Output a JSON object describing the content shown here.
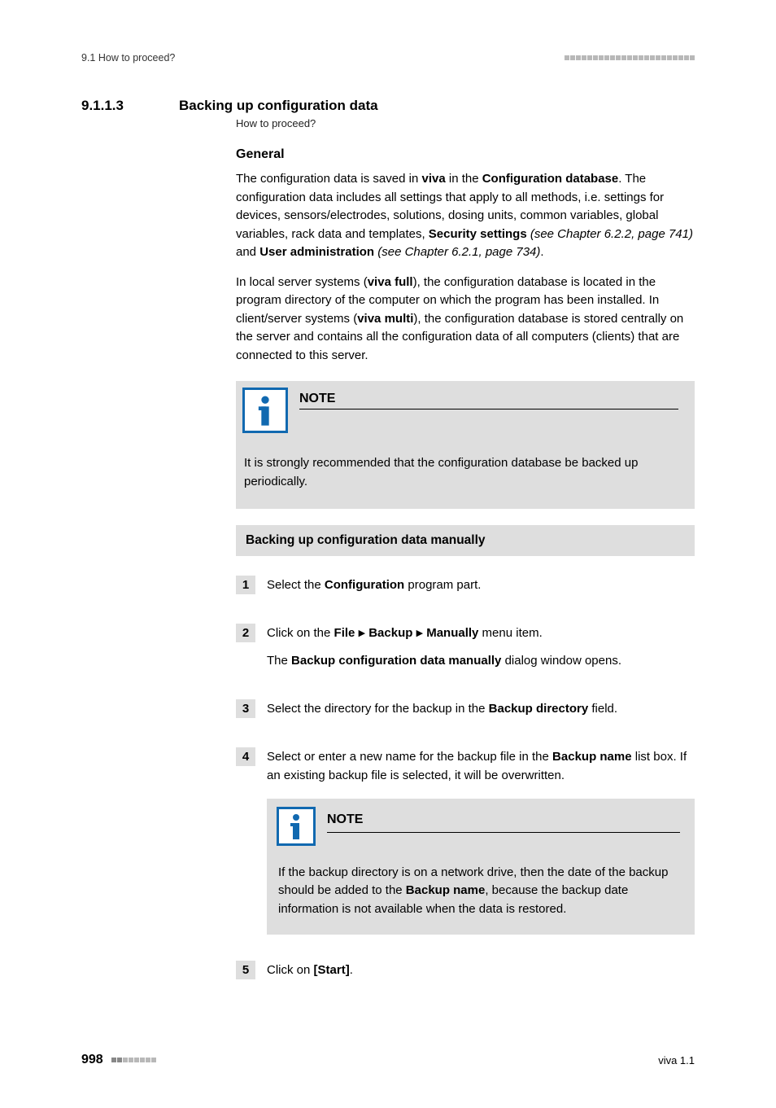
{
  "header": {
    "left": "9.1 How to proceed?"
  },
  "section": {
    "number": "9.1.1.3",
    "title": "Backing up configuration data",
    "subtitle": "How to proceed?"
  },
  "general": {
    "heading": "General",
    "p1a": "The configuration data is saved in ",
    "p1b": "viva",
    "p1c": " in the ",
    "p1d": "Configuration database",
    "p1e": ". The configuration data includes all settings that apply to all methods, i.e. settings for devices, sensors/electrodes, solutions, dosing units, common variables, global variables, rack data and templates, ",
    "p1f": "Security settings",
    "p1g": " (see Chapter 6.2.2, page 741)",
    "p1h": " and ",
    "p1i": "User administration",
    "p1j": " (see Chapter 6.2.1, page 734)",
    "p1k": ".",
    "p2a": "In local server systems (",
    "p2b": "viva full",
    "p2c": "), the configuration database is located in the program directory of the computer on which the program has been installed. In client/server systems (",
    "p2d": "viva multi",
    "p2e": "), the configuration database is stored centrally on the server and contains all the configuration data of all computers (clients) that are connected to this server."
  },
  "note1": {
    "title": "NOTE",
    "body": "It is strongly recommended that the configuration database be backed up periodically."
  },
  "procedure": {
    "title": "Backing up configuration data manually"
  },
  "steps": {
    "s1": {
      "num": "1",
      "a": "Select the ",
      "b": "Configuration",
      "c": " program part."
    },
    "s2": {
      "num": "2",
      "l1a": "Click on the ",
      "l1b": "File",
      "l1c": "Backup",
      "l1d": "Manually",
      "l1e": " menu item.",
      "l2a": "The ",
      "l2b": "Backup configuration data manually",
      "l2c": " dialog window opens."
    },
    "s3": {
      "num": "3",
      "a": "Select the directory for the backup in the ",
      "b": "Backup directory",
      "c": " field."
    },
    "s4": {
      "num": "4",
      "a": "Select or enter a new name for the backup file in the ",
      "b": "Backup name",
      "c": " list box. If an existing backup file is selected, it will be overwritten.",
      "noteTitle": "NOTE",
      "noteA": "If the backup directory is on a network drive, then the date of the backup should be added to the ",
      "noteB": "Backup name",
      "noteC": ", because the backup date information is not available when the data is restored."
    },
    "s5": {
      "num": "5",
      "a": "Click on ",
      "b": "[Start]",
      "c": "."
    }
  },
  "footer": {
    "page": "998",
    "right": "viva 1.1"
  }
}
